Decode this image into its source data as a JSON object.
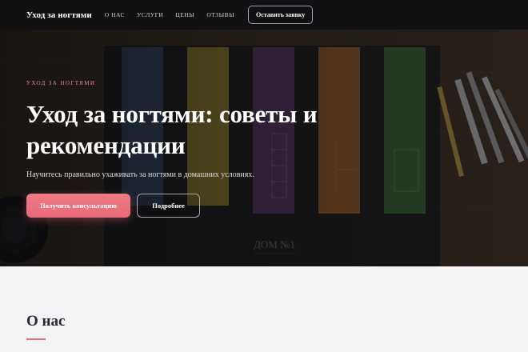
{
  "header": {
    "brand": "Уход за ногтями",
    "nav": [
      {
        "label": "О нас"
      },
      {
        "label": "Услуги"
      },
      {
        "label": "Цены"
      },
      {
        "label": "Отзывы"
      }
    ],
    "cta_label": "Оставить заявку"
  },
  "hero": {
    "eyebrow": "Уход за ногтями",
    "title": "Уход за ногтями: советы и рекомендации",
    "subtitle": "Научитесь правильно ухаживать за ногтями в домашних условиях.",
    "primary_button": "Получить консультацию",
    "secondary_button": "Подробнее",
    "background_text": {
      "board_title": "ДОМ №1"
    }
  },
  "about": {
    "title": "О нас"
  },
  "colors": {
    "accent": "#e86a77",
    "header_bg": "#111113",
    "heading_dark": "#2b2138",
    "section_bg": "#f4f3f6"
  }
}
